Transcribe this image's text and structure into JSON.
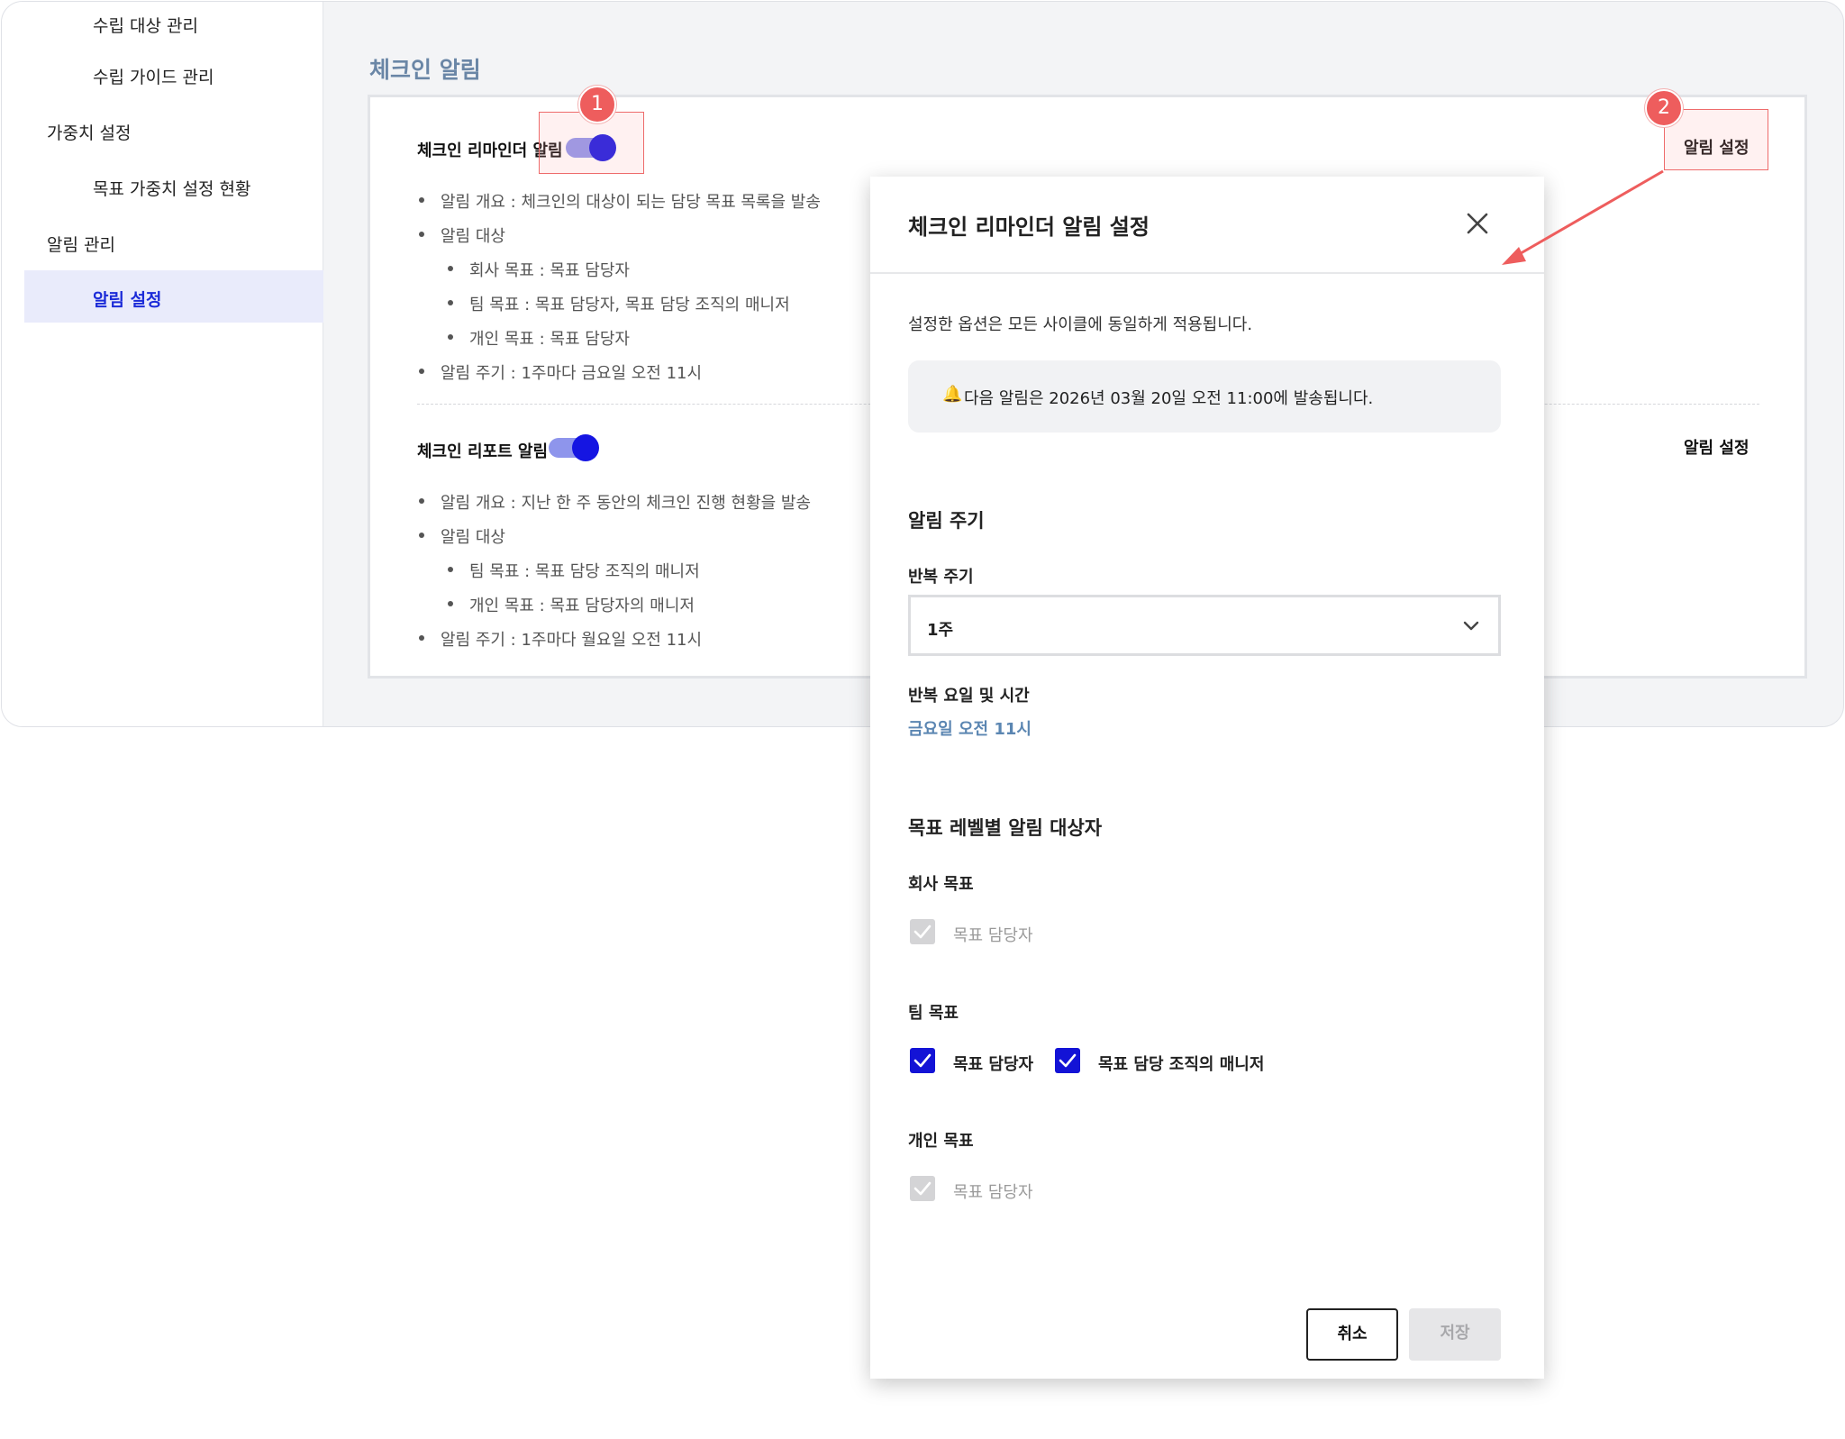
{
  "sidebar": {
    "items": [
      {
        "label": "수립 대상 관리"
      },
      {
        "label": "수립 가이드 관리"
      },
      {
        "label": "가중치 설정"
      },
      {
        "label": "목표 가중치 설정 현황"
      },
      {
        "label": "알림 관리"
      },
      {
        "label": "알림 설정"
      }
    ]
  },
  "main": {
    "title": "체크인 알림",
    "reminder": {
      "title": "체크인 리마인더 알림",
      "settings_link": "알림 설정",
      "bullets": [
        "알림 개요 : 체크인의 대상이 되는 담당 목표 목록을 발송",
        "알림 대상",
        "회사 목표 : 목표 담당자",
        "팀 목표 : 목표 담당자, 목표 담당 조직의 매니저",
        "개인 목표 : 목표 담당자",
        "알림 주기 : 1주마다 금요일 오전 11시"
      ]
    },
    "report": {
      "title": "체크인 리포트 알림",
      "settings_link": "알림 설정",
      "bullets": [
        "알림 개요 : 지난 한 주 동안의 체크인 진행 현황을 발송",
        "알림 대상",
        "팀 목표 : 목표 담당 조직의 매니저",
        "개인 목표 : 목표 담당자의 매니저",
        "알림 주기 : 1주마다 월요일 오전 11시"
      ]
    }
  },
  "annotations": {
    "badge1": "1",
    "badge2": "2",
    "color": "#ee5d5d"
  },
  "modal": {
    "title": "체크인 리마인더 알림 설정",
    "description": "설정한 옵션은 모든 사이클에 동일하게 적용됩니다.",
    "notice_icon": "🔔",
    "notice": "다음 알림은 2026년 03월 20일 오전 11:00에 발송됩니다.",
    "cycle_heading": "알림 주기",
    "repeat_label": "반복 주기",
    "repeat_value": "1주",
    "day_time_label": "반복 요일 및 시간",
    "day_time_value": "금요일 오전 11시",
    "targets_heading": "목표 레벨별 알림 대상자",
    "company": {
      "label": "회사 목표",
      "option": "목표 담당자"
    },
    "team": {
      "label": "팀 목표",
      "option1": "목표 담당자",
      "option2": "목표 담당 조직의 매니저"
    },
    "personal": {
      "label": "개인 목표",
      "option": "목표 담당자"
    },
    "cancel": "취소",
    "save": "저장"
  },
  "colors": {
    "accent": "#1515e2",
    "link": "#5b86b2",
    "active_nav_bg": "#e9ebfb"
  }
}
